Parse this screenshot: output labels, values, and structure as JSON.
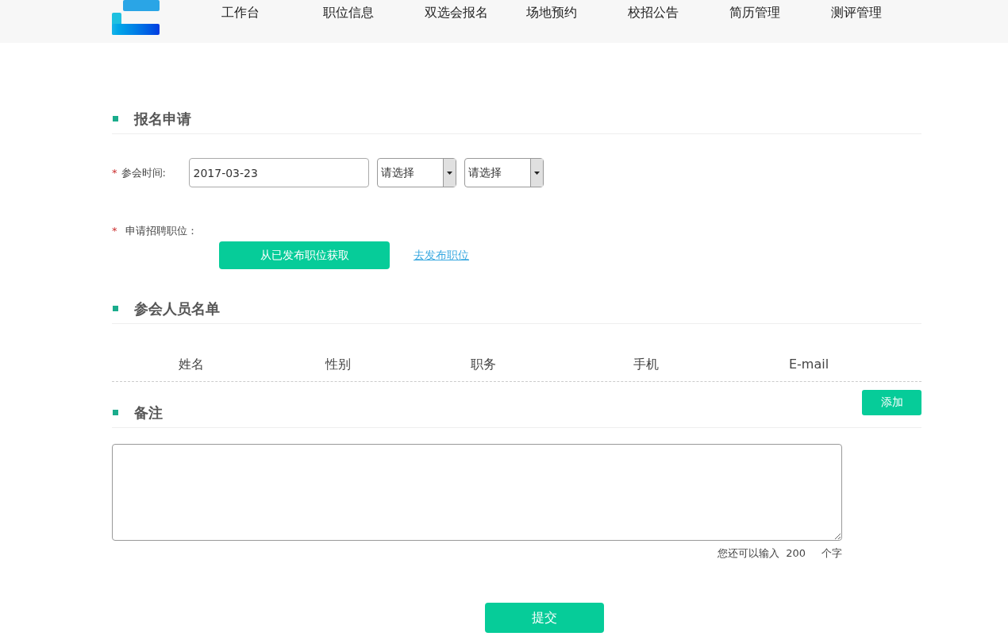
{
  "nav": [
    {
      "label": "工作台"
    },
    {
      "label": "职位信息"
    },
    {
      "label": "双选会报名"
    },
    {
      "label": "场地预约"
    },
    {
      "label": "校招公告"
    },
    {
      "label": "简历管理"
    },
    {
      "label": "测评管理"
    }
  ],
  "apply": {
    "title": "报名申请",
    "time": {
      "mark": "*",
      "label": "参会时间:",
      "date": "2017-03-23",
      "selects": [
        "请选择",
        "请选择"
      ]
    },
    "position": {
      "mark": "*",
      "label": "申请招聘职位：",
      "fetch_button": "从已发布职位获取",
      "link": "去发布职位"
    }
  },
  "attendees": {
    "title": "参会人员名单",
    "columns": [
      "姓名",
      "性别",
      "职务",
      "手机",
      "E-mail"
    ],
    "add_button": "添加"
  },
  "remarks": {
    "title": "备注",
    "counter_prefix": "您还可以输入",
    "counter_value": "200",
    "counter_suffix": "个字"
  },
  "submit": "提交"
}
